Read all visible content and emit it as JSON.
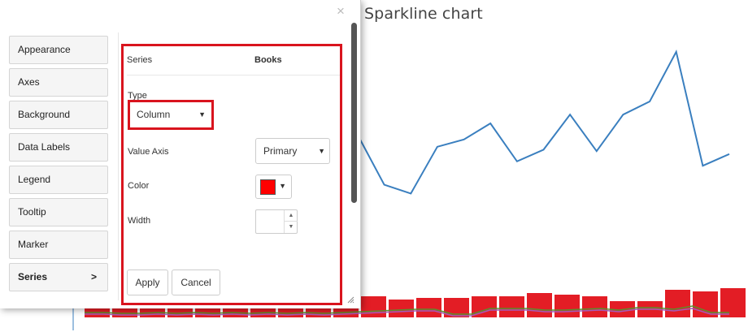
{
  "chart": {
    "title": "Sparkline chart"
  },
  "chart_data": {
    "type": "line",
    "title": "Sparkline chart",
    "series": [
      {
        "values": [
          52,
          18,
          12,
          44,
          49,
          60,
          34,
          42,
          66,
          41,
          66,
          75,
          109,
          31,
          39
        ]
      }
    ],
    "columns": [
      14,
      14,
      14,
      14,
      12,
      16,
      15,
      14,
      15,
      13,
      13,
      11,
      12,
      12,
      13,
      13,
      15,
      14,
      13,
      10,
      10,
      17,
      16,
      18,
      14,
      14,
      16,
      14,
      16,
      16,
      21,
      19,
      19
    ],
    "minor_lines": [
      {
        "color": "#5a8f2e",
        "values": [
          6,
          6,
          5,
          5,
          6,
          5,
          6,
          5,
          6,
          5,
          6,
          5,
          6,
          5,
          6,
          7,
          8,
          9,
          10,
          10,
          4,
          4,
          11,
          11,
          11,
          9,
          9,
          10,
          11,
          9,
          12,
          12,
          10,
          14,
          6,
          6
        ]
      },
      {
        "color": "#a45bb8",
        "values": [
          4,
          4,
          3,
          3,
          4,
          3,
          4,
          3,
          4,
          3,
          4,
          3,
          4,
          3,
          4,
          5,
          6,
          7,
          8,
          8,
          2,
          2,
          9,
          9,
          9,
          7,
          7,
          8,
          9,
          7,
          10,
          10,
          8,
          11,
          4,
          4
        ]
      }
    ],
    "colors": {
      "line": "#3a7fbf",
      "column": "#e31d25"
    },
    "grid": false
  },
  "panel": {
    "menu": [
      {
        "label": "Appearance"
      },
      {
        "label": "Axes"
      },
      {
        "label": "Background"
      },
      {
        "label": "Data Labels"
      },
      {
        "label": "Legend"
      },
      {
        "label": "Tooltip"
      },
      {
        "label": "Marker"
      },
      {
        "label": "Series",
        "arrow": ">"
      }
    ],
    "active_menu": "Series",
    "series_header": {
      "label": "Series",
      "value": "Books"
    },
    "type": {
      "label": "Type",
      "value": "Column"
    },
    "value_axis": {
      "label": "Value Axis",
      "value": "Primary"
    },
    "color": {
      "label": "Color",
      "value": "#ff0000"
    },
    "width": {
      "label": "Width",
      "value": ""
    },
    "apply_label": "Apply",
    "cancel_label": "Cancel",
    "close_glyph": "×"
  },
  "colors": {
    "highlight": "#d9141e"
  }
}
